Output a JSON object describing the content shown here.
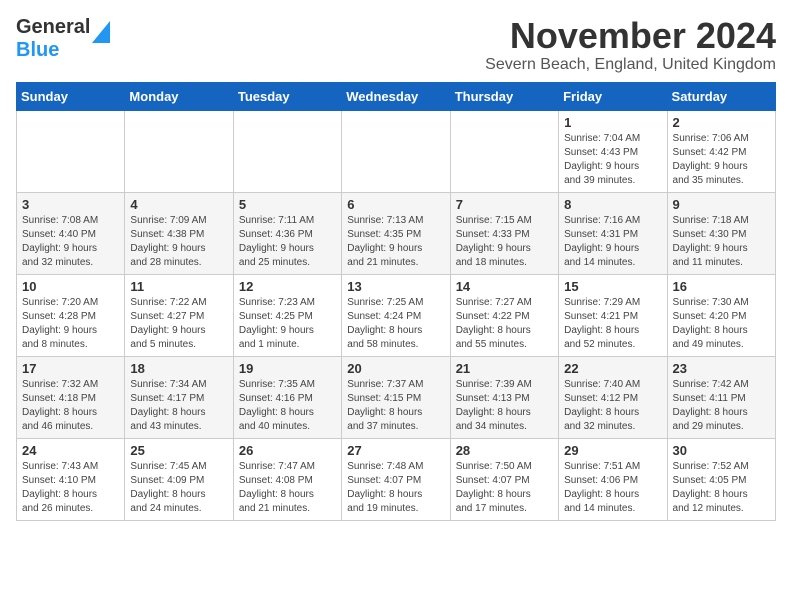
{
  "logo": {
    "line1": "General",
    "line2": "Blue"
  },
  "title": "November 2024",
  "location": "Severn Beach, England, United Kingdom",
  "days_of_week": [
    "Sunday",
    "Monday",
    "Tuesday",
    "Wednesday",
    "Thursday",
    "Friday",
    "Saturday"
  ],
  "weeks": [
    [
      {
        "day": "",
        "detail": ""
      },
      {
        "day": "",
        "detail": ""
      },
      {
        "day": "",
        "detail": ""
      },
      {
        "day": "",
        "detail": ""
      },
      {
        "day": "",
        "detail": ""
      },
      {
        "day": "1",
        "detail": "Sunrise: 7:04 AM\nSunset: 4:43 PM\nDaylight: 9 hours\nand 39 minutes."
      },
      {
        "day": "2",
        "detail": "Sunrise: 7:06 AM\nSunset: 4:42 PM\nDaylight: 9 hours\nand 35 minutes."
      }
    ],
    [
      {
        "day": "3",
        "detail": "Sunrise: 7:08 AM\nSunset: 4:40 PM\nDaylight: 9 hours\nand 32 minutes."
      },
      {
        "day": "4",
        "detail": "Sunrise: 7:09 AM\nSunset: 4:38 PM\nDaylight: 9 hours\nand 28 minutes."
      },
      {
        "day": "5",
        "detail": "Sunrise: 7:11 AM\nSunset: 4:36 PM\nDaylight: 9 hours\nand 25 minutes."
      },
      {
        "day": "6",
        "detail": "Sunrise: 7:13 AM\nSunset: 4:35 PM\nDaylight: 9 hours\nand 21 minutes."
      },
      {
        "day": "7",
        "detail": "Sunrise: 7:15 AM\nSunset: 4:33 PM\nDaylight: 9 hours\nand 18 minutes."
      },
      {
        "day": "8",
        "detail": "Sunrise: 7:16 AM\nSunset: 4:31 PM\nDaylight: 9 hours\nand 14 minutes."
      },
      {
        "day": "9",
        "detail": "Sunrise: 7:18 AM\nSunset: 4:30 PM\nDaylight: 9 hours\nand 11 minutes."
      }
    ],
    [
      {
        "day": "10",
        "detail": "Sunrise: 7:20 AM\nSunset: 4:28 PM\nDaylight: 9 hours\nand 8 minutes."
      },
      {
        "day": "11",
        "detail": "Sunrise: 7:22 AM\nSunset: 4:27 PM\nDaylight: 9 hours\nand 5 minutes."
      },
      {
        "day": "12",
        "detail": "Sunrise: 7:23 AM\nSunset: 4:25 PM\nDaylight: 9 hours\nand 1 minute."
      },
      {
        "day": "13",
        "detail": "Sunrise: 7:25 AM\nSunset: 4:24 PM\nDaylight: 8 hours\nand 58 minutes."
      },
      {
        "day": "14",
        "detail": "Sunrise: 7:27 AM\nSunset: 4:22 PM\nDaylight: 8 hours\nand 55 minutes."
      },
      {
        "day": "15",
        "detail": "Sunrise: 7:29 AM\nSunset: 4:21 PM\nDaylight: 8 hours\nand 52 minutes."
      },
      {
        "day": "16",
        "detail": "Sunrise: 7:30 AM\nSunset: 4:20 PM\nDaylight: 8 hours\nand 49 minutes."
      }
    ],
    [
      {
        "day": "17",
        "detail": "Sunrise: 7:32 AM\nSunset: 4:18 PM\nDaylight: 8 hours\nand 46 minutes."
      },
      {
        "day": "18",
        "detail": "Sunrise: 7:34 AM\nSunset: 4:17 PM\nDaylight: 8 hours\nand 43 minutes."
      },
      {
        "day": "19",
        "detail": "Sunrise: 7:35 AM\nSunset: 4:16 PM\nDaylight: 8 hours\nand 40 minutes."
      },
      {
        "day": "20",
        "detail": "Sunrise: 7:37 AM\nSunset: 4:15 PM\nDaylight: 8 hours\nand 37 minutes."
      },
      {
        "day": "21",
        "detail": "Sunrise: 7:39 AM\nSunset: 4:13 PM\nDaylight: 8 hours\nand 34 minutes."
      },
      {
        "day": "22",
        "detail": "Sunrise: 7:40 AM\nSunset: 4:12 PM\nDaylight: 8 hours\nand 32 minutes."
      },
      {
        "day": "23",
        "detail": "Sunrise: 7:42 AM\nSunset: 4:11 PM\nDaylight: 8 hours\nand 29 minutes."
      }
    ],
    [
      {
        "day": "24",
        "detail": "Sunrise: 7:43 AM\nSunset: 4:10 PM\nDaylight: 8 hours\nand 26 minutes."
      },
      {
        "day": "25",
        "detail": "Sunrise: 7:45 AM\nSunset: 4:09 PM\nDaylight: 8 hours\nand 24 minutes."
      },
      {
        "day": "26",
        "detail": "Sunrise: 7:47 AM\nSunset: 4:08 PM\nDaylight: 8 hours\nand 21 minutes."
      },
      {
        "day": "27",
        "detail": "Sunrise: 7:48 AM\nSunset: 4:07 PM\nDaylight: 8 hours\nand 19 minutes."
      },
      {
        "day": "28",
        "detail": "Sunrise: 7:50 AM\nSunset: 4:07 PM\nDaylight: 8 hours\nand 17 minutes."
      },
      {
        "day": "29",
        "detail": "Sunrise: 7:51 AM\nSunset: 4:06 PM\nDaylight: 8 hours\nand 14 minutes."
      },
      {
        "day": "30",
        "detail": "Sunrise: 7:52 AM\nSunset: 4:05 PM\nDaylight: 8 hours\nand 12 minutes."
      }
    ]
  ]
}
